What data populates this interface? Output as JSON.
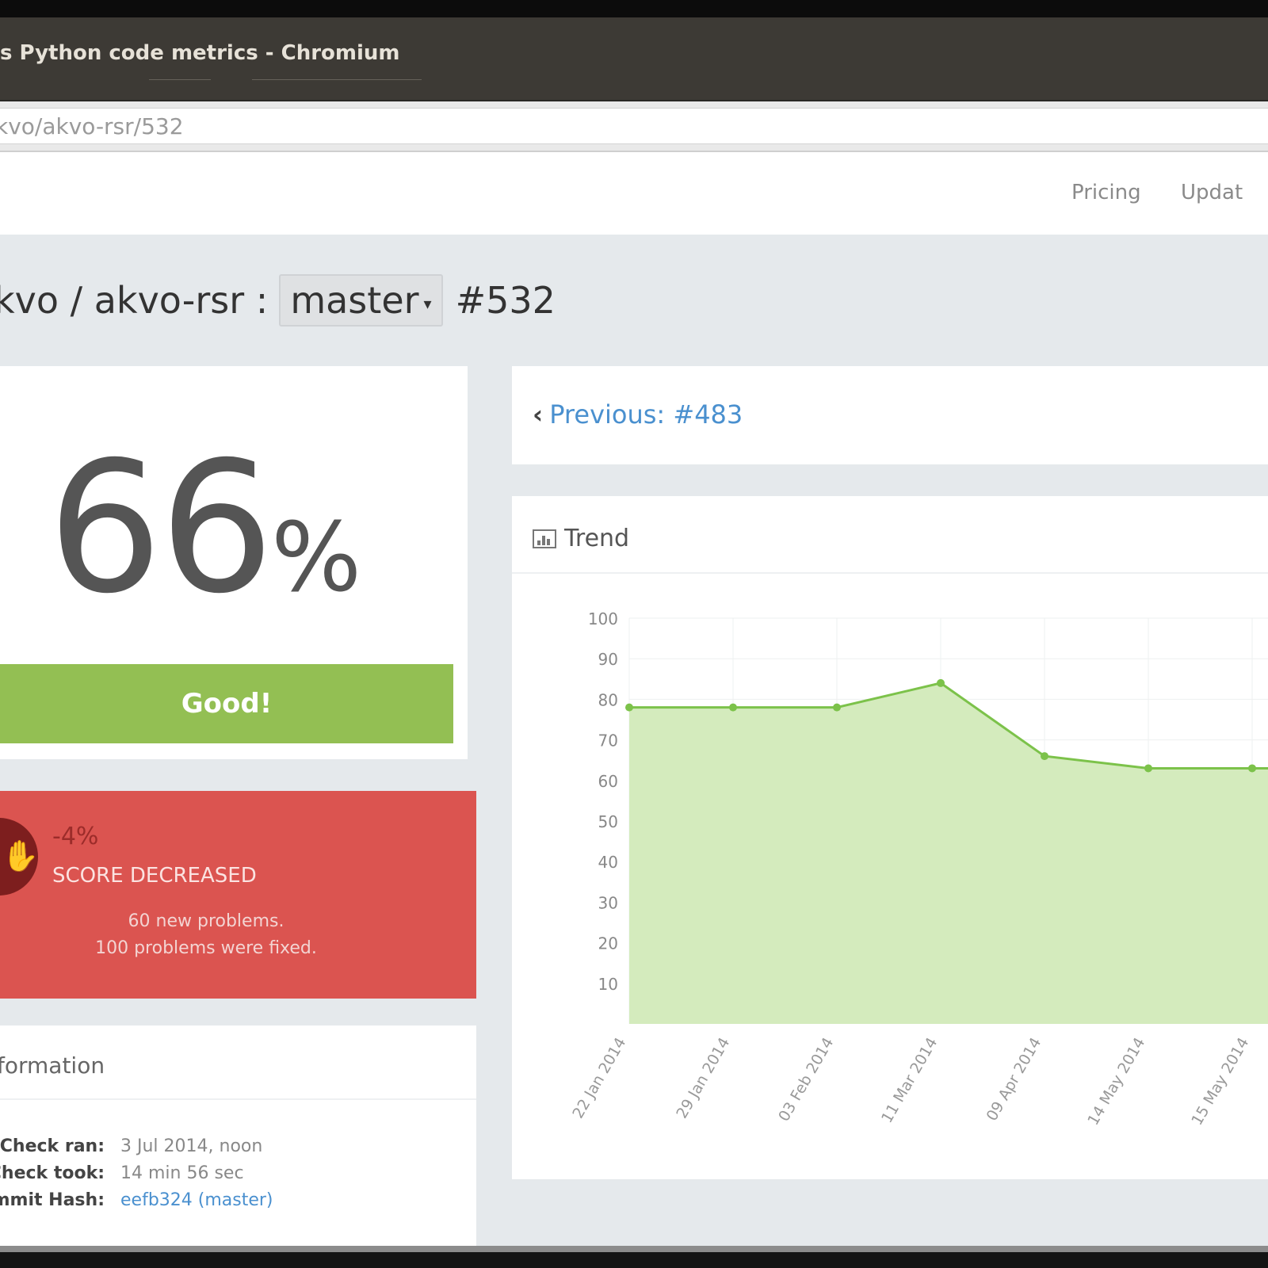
{
  "window": {
    "title": "s Python code metrics - Chromium"
  },
  "browser": {
    "url": "kvo/akvo-rsr/532"
  },
  "nav": {
    "pricing": "Pricing",
    "updates": "Updat"
  },
  "repo": {
    "path": "kvo / akvo-rsr :",
    "branch": "master",
    "branch_caret": "▾",
    "build": "#532"
  },
  "score": {
    "value": "66",
    "unit": "%",
    "verdict": "Good!"
  },
  "change": {
    "delta": "-4%",
    "label": "SCORE DECREASED",
    "new_problems": "60 new problems.",
    "fixed_problems": "100 problems were fixed.",
    "icon": "thumbs-down-icon"
  },
  "info": {
    "title": "formation",
    "rows": [
      {
        "key": "Check ran:",
        "value": "3 Jul 2014, noon"
      },
      {
        "key": "Check took:",
        "value": "14 min 56 sec"
      },
      {
        "key": "mmit Hash:",
        "value": "eefb324 (master)"
      }
    ]
  },
  "previous": {
    "chevron": "‹",
    "label": "Previous: #483"
  },
  "trend": {
    "title": "Trend",
    "icon": "chart-icon"
  },
  "colors": {
    "good": "#93bf53",
    "alert": "#db5450",
    "link": "#4a90cf",
    "line": "#7cc24a",
    "fill": "#d4ebbd"
  },
  "chart_data": {
    "type": "area",
    "x": [
      "22 Jan 2014",
      "29 Jan 2014",
      "03 Feb 2014",
      "11 Mar 2014",
      "09 Apr 2014",
      "14 May 2014",
      "15 May 2014"
    ],
    "values": [
      78,
      78,
      78,
      84,
      66,
      63,
      63
    ],
    "ylim": [
      0,
      100
    ],
    "yticks": [
      10,
      20,
      30,
      40,
      50,
      60,
      70,
      80,
      90,
      100
    ],
    "grid": true
  }
}
